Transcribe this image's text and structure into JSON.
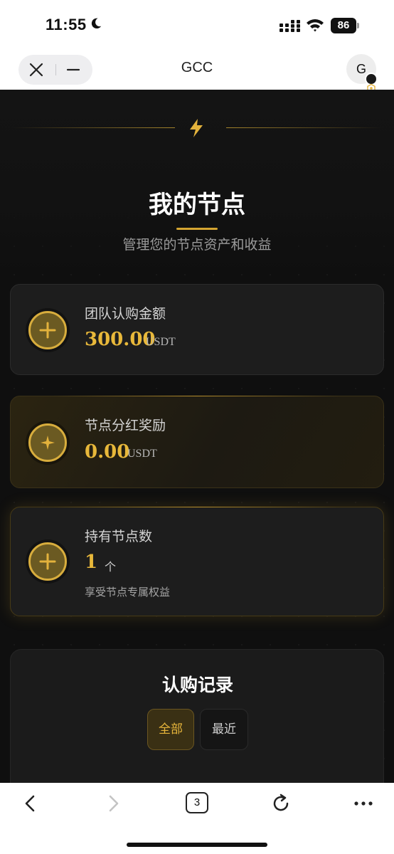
{
  "status_bar": {
    "time": "11:55",
    "battery": "86"
  },
  "browser": {
    "title": "GCC",
    "avatar_letter": "G",
    "tab_count": "3"
  },
  "hero": {
    "title": "我的节点",
    "subtitle": "管理您的节点资产和收益"
  },
  "cards": [
    {
      "label": "团队认购金额",
      "value": "300.00",
      "unit": "USDT",
      "icon": "plus-circle-icon"
    },
    {
      "label": "节点分红奖励",
      "value": "0.00",
      "unit": "USDT",
      "icon": "sparkle-icon"
    },
    {
      "label": "持有节点数",
      "value": "1",
      "unit": "个",
      "note": "享受节点专属权益",
      "icon": "plus-circle-icon"
    }
  ],
  "records": {
    "title": "认购记录",
    "tabs": [
      {
        "label": "全部",
        "active": true
      },
      {
        "label": "最近",
        "active": false
      }
    ]
  },
  "colors": {
    "accent": "#d4a531",
    "background": "#0f0f0f",
    "card": "#1d1d1d"
  }
}
